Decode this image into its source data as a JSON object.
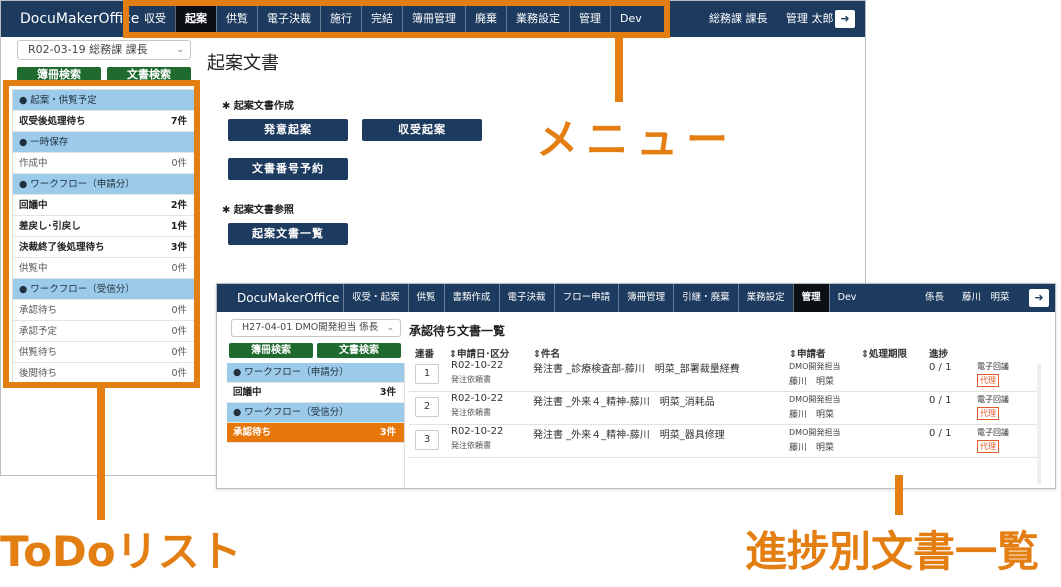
{
  "win1": {
    "brand": "DocuMakerOffice",
    "menu": [
      "収受",
      "起案",
      "供覧",
      "電子決裁",
      "施行",
      "完結",
      "簿冊管理",
      "廃棄",
      "業務設定",
      "管理",
      "Dev"
    ],
    "user_dept": "総務課 課長",
    "user_name": "管理 太郎",
    "logout_icon": "➜",
    "select_value": "R02-03-19 総務課 課長",
    "btn_search_ledger": "簿冊検索",
    "btn_search_doc": "文書検索",
    "todo": [
      {
        "type": "hdr",
        "label": "● 起案・供覧予定",
        "count": ""
      },
      {
        "type": "bold",
        "label": "収受後処理待ち",
        "count": "7件"
      },
      {
        "type": "hdr",
        "label": "● 一時保存",
        "count": ""
      },
      {
        "type": "normal",
        "label": "作成中",
        "count": "0件"
      },
      {
        "type": "hdr",
        "label": "● ワークフロー（申請分）",
        "count": ""
      },
      {
        "type": "bold",
        "label": "回議中",
        "count": "2件"
      },
      {
        "type": "bold",
        "label": "差戻し･引戻し",
        "count": "1件"
      },
      {
        "type": "bold",
        "label": "決裁終了後処理待ち",
        "count": "3件"
      },
      {
        "type": "normal",
        "label": "供覧中",
        "count": "0件"
      },
      {
        "type": "hdr",
        "label": "● ワークフロー（受信分）",
        "count": ""
      },
      {
        "type": "normal",
        "label": "承認待ち",
        "count": "0件"
      },
      {
        "type": "normal",
        "label": "承認予定",
        "count": "0件"
      },
      {
        "type": "normal",
        "label": "供覧待ち",
        "count": "0件"
      },
      {
        "type": "normal",
        "label": "後閲待ち",
        "count": "0件"
      }
    ],
    "page_title": "起案文書",
    "section_create": "✱ 起案文書作成",
    "btn_hatsui": "発意起案",
    "btn_shuju": "収受起案",
    "btn_yoyaku": "文書番号予約",
    "section_ref": "✱ 起案文書参照",
    "btn_list": "起案文書一覧"
  },
  "labels": {
    "menu": "メニュー",
    "todo": "ToDoリスト",
    "progress": "進捗別文書一覧"
  },
  "win2": {
    "brand": "DocuMakerOffice",
    "menu": [
      "収受・起案",
      "供覧",
      "書類作成",
      "電子決裁",
      "フロー申請",
      "簿冊管理",
      "引継・廃棄",
      "業務設定",
      "管理",
      "Dev"
    ],
    "user_role": "係長",
    "user_name": "藤川　明菜",
    "logout_icon": "➜",
    "select_value": "H27-04-01 DMO開発担当 係長",
    "btn_search_ledger": "簿冊検索",
    "btn_search_doc": "文書検索",
    "todo": [
      {
        "type": "hdr",
        "label": "● ワークフロー（申請分）",
        "count": ""
      },
      {
        "type": "bold",
        "label": "回議中",
        "count": "3件"
      },
      {
        "type": "hdr",
        "label": "● ワークフロー（受信分）",
        "count": ""
      },
      {
        "type": "orange",
        "label": "承認待ち",
        "count": "3件"
      }
    ],
    "list_title": "承認待ち文書一覧",
    "columns": {
      "no": "連番",
      "date": "⇕申請日･区分",
      "name": "⇕件名",
      "applicant": "⇕申請者",
      "deadline": "⇕処理期限",
      "progress": "進捗"
    },
    "rows": [
      {
        "no": "1",
        "date": "R02-10-22",
        "sub": "発注依頼書",
        "name": "発注書 _診療検査部-藤川　明菜_部署裁量経費",
        "dept": "DMO開発担当",
        "person": "藤川　明菜",
        "progress": "0 / 1",
        "method": "電子回議",
        "badge": "代理"
      },
      {
        "no": "2",
        "date": "R02-10-22",
        "sub": "発注依頼書",
        "name": "発注書 _外来４_精神-藤川　明菜_消耗品",
        "dept": "DMO開発担当",
        "person": "藤川　明菜",
        "progress": "0 / 1",
        "method": "電子回議",
        "badge": "代理"
      },
      {
        "no": "3",
        "date": "R02-10-22",
        "sub": "発注依頼書",
        "name": "発注書 _外来４_精神-藤川　明菜_器具修理",
        "dept": "DMO開発担当",
        "person": "藤川　明菜",
        "progress": "0 / 1",
        "method": "電子回議",
        "badge": "代理"
      }
    ]
  }
}
